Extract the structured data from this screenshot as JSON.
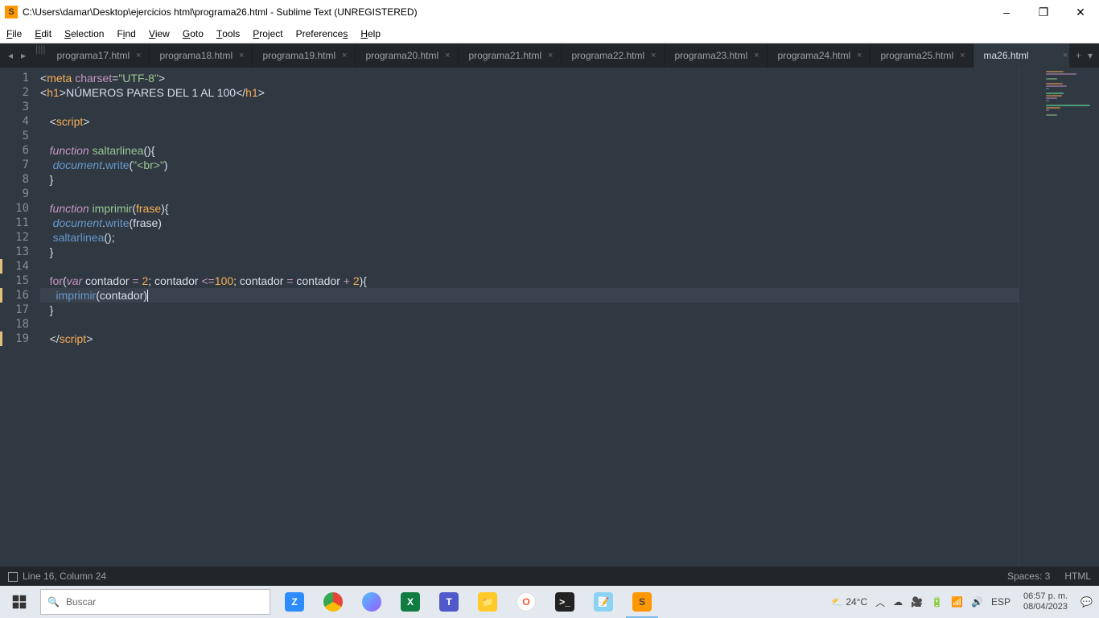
{
  "titlebar": {
    "title": "C:\\Users\\damar\\Desktop\\ejercicios html\\programa26.html - Sublime Text (UNREGISTERED)"
  },
  "menu": [
    {
      "u": "F",
      "rest": "ile"
    },
    {
      "u": "E",
      "rest": "dit"
    },
    {
      "u": "S",
      "rest": "election"
    },
    {
      "u": "F",
      "rest": "ind",
      "pre": "",
      "text": "Find"
    },
    {
      "u": "V",
      "rest": "iew"
    },
    {
      "u": "G",
      "rest": "oto"
    },
    {
      "u": "T",
      "rest": "ools"
    },
    {
      "u": "P",
      "rest": "roject"
    },
    {
      "u": "P",
      "rest": "references",
      "text": "Preferences",
      "noU": true
    },
    {
      "u": "H",
      "rest": "elp"
    }
  ],
  "tabs": [
    {
      "name": "programa17.html",
      "active": false
    },
    {
      "name": "programa18.html",
      "active": false
    },
    {
      "name": "programa19.html",
      "active": false
    },
    {
      "name": "programa20.html",
      "active": false
    },
    {
      "name": "programa21.html",
      "active": false
    },
    {
      "name": "programa22.html",
      "active": false
    },
    {
      "name": "programa23.html",
      "active": false
    },
    {
      "name": "programa24.html",
      "active": false
    },
    {
      "name": "programa25.html",
      "active": false
    },
    {
      "name": "ma26.html",
      "full": "programa26.html",
      "active": true
    }
  ],
  "code": {
    "lines": [
      {
        "n": 1,
        "html": "<span class='p'>&lt;</span><span class='t'>meta</span> <span class='a'>charset</span><span class='p'>=</span><span class='s'>\"UTF-8\"</span><span class='p'>&gt;</span>"
      },
      {
        "n": 2,
        "html": "<span class='p'>&lt;</span><span class='t'>h1</span><span class='p'>&gt;</span>NÚMEROS PARES DEL 1 AL 100<span class='p'>&lt;/</span><span class='t'>h1</span><span class='p'>&gt;</span>"
      },
      {
        "n": 3,
        "html": ""
      },
      {
        "n": 4,
        "html": "   <span class='p'>&lt;</span><span class='t'>script</span><span class='p'>&gt;</span>"
      },
      {
        "n": 5,
        "html": ""
      },
      {
        "n": 6,
        "html": "   <span class='st'>function</span> <span class='def'>saltarlinea</span><span class='p'>(){</span>"
      },
      {
        "n": 7,
        "html": "    <span class='doc'>document</span><span class='p'>.</span><span class='fn'>write</span><span class='p'>(</span><span class='s'>\"&lt;br&gt;\"</span><span class='p'>)</span>"
      },
      {
        "n": 8,
        "html": "   <span class='p'>}</span>"
      },
      {
        "n": 9,
        "html": ""
      },
      {
        "n": 10,
        "html": "   <span class='st'>function</span> <span class='def'>imprimir</span><span class='p'>(</span><span class='var'>frase</span><span class='p'>){</span>"
      },
      {
        "n": 11,
        "html": "    <span class='doc'>document</span><span class='p'>.</span><span class='fn'>write</span><span class='p'>(frase)</span>"
      },
      {
        "n": 12,
        "html": "    <span class='fn'>saltarlinea</span><span class='p'>();</span>"
      },
      {
        "n": 13,
        "html": "   <span class='p'>}</span>"
      },
      {
        "n": 14,
        "mod": true,
        "html": ""
      },
      {
        "n": 15,
        "html": "   <span class='k'>for</span><span class='p'>(</span><span class='st'>var</span> contador <span class='k'>=</span> <span class='t'>2</span><span class='p'>;</span> contador <span class='k'>&lt;=</span><span class='t'>100</span><span class='p'>;</span> contador <span class='k'>=</span> contador <span class='k'>+</span> <span class='t'>2</span><span class='p'>){</span>"
      },
      {
        "n": 16,
        "mod": true,
        "current": true,
        "html": "     <span class='fn'>imprimir</span><span class='p'>(contador)</span><span class='caret'></span>"
      },
      {
        "n": 17,
        "html": "   <span class='p'>}</span>"
      },
      {
        "n": 18,
        "html": ""
      },
      {
        "n": 19,
        "mod": true,
        "html": "   <span class='p'>&lt;/</span><span class='t'>script</span><span class='p'>&gt;</span>"
      }
    ]
  },
  "statusbar": {
    "left": "Line 16, Column 24",
    "spaces": "Spaces: 3",
    "lang": "HTML"
  },
  "taskbar": {
    "search_placeholder": "Buscar",
    "weather_temp": "24°C",
    "lang": "ESP",
    "time": "06:57 p. m.",
    "date": "08/04/2023"
  }
}
